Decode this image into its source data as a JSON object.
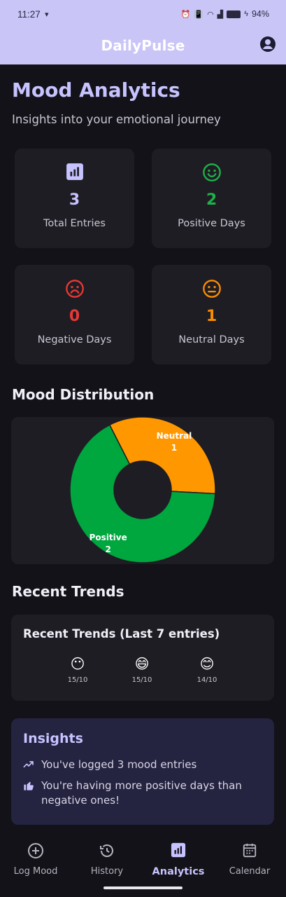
{
  "status_bar": {
    "time": "11:27",
    "battery": "94%"
  },
  "app": {
    "title": "DailyPulse"
  },
  "page": {
    "title": "Mood Analytics",
    "subtitle": "Insights into your emotional journey"
  },
  "stats": [
    {
      "value": "3",
      "label": "Total Entries",
      "color": "#c7c3ff",
      "icon": "chart-icon"
    },
    {
      "value": "2",
      "label": "Positive Days",
      "color": "#1fb14a",
      "icon": "happy-face-icon"
    },
    {
      "value": "0",
      "label": "Negative Days",
      "color": "#e53935",
      "icon": "sad-face-icon"
    },
    {
      "value": "1",
      "label": "Neutral Days",
      "color": "#fb8c00",
      "icon": "neutral-face-icon"
    }
  ],
  "distribution": {
    "title": "Mood Distribution",
    "chart_data": {
      "type": "pie",
      "categories": [
        "Neutral",
        "Positive"
      ],
      "values": [
        1,
        2
      ],
      "colors": [
        "#ff9800",
        "#00a63e"
      ],
      "labels": [
        "Neutral",
        "Positive"
      ]
    }
  },
  "trends": {
    "section_title": "Recent Trends",
    "card_title": "Recent Trends (Last 7 entries)",
    "entries": [
      {
        "emoji": "😶",
        "date": "15/10"
      },
      {
        "emoji": "😄",
        "date": "15/10"
      },
      {
        "emoji": "😊",
        "date": "14/10"
      }
    ]
  },
  "insights": {
    "title": "Insights",
    "items": [
      "You've logged 3 mood entries",
      "You're having more positive days than negative ones!"
    ]
  },
  "nav": [
    {
      "label": "Log Mood",
      "icon": "add-circle-icon"
    },
    {
      "label": "History",
      "icon": "history-icon"
    },
    {
      "label": "Analytics",
      "icon": "analytics-icon",
      "active": true
    },
    {
      "label": "Calendar",
      "icon": "calendar-icon"
    }
  ]
}
